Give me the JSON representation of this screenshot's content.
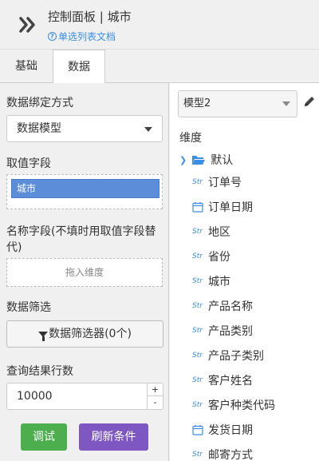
{
  "header": {
    "title": "控制面板 | 城市",
    "help_link": "单选列表文档"
  },
  "tabs": [
    {
      "label": "基础",
      "active": false
    },
    {
      "label": "数据",
      "active": true
    }
  ],
  "left": {
    "binding_label": "数据绑定方式",
    "binding_value": "数据模型",
    "value_field_label": "取值字段",
    "value_field_chip": "城市",
    "name_field_label": "名称字段(不填时用取值字段替代)",
    "name_field_hint": "拖入维度",
    "filter_label": "数据筛选",
    "filter_button": "数据筛选器(0个)",
    "rows_label": "查询结果行数",
    "rows_value": "10000",
    "stepper_up": "+",
    "stepper_down": "-",
    "debug_button": "调试",
    "refresh_button": "刷新条件"
  },
  "right": {
    "model_value": "模型2",
    "dimension_label": "维度",
    "folder_label": "默认",
    "str_tag": "Str",
    "fields": [
      {
        "label": "订单号",
        "type": "str"
      },
      {
        "label": "订单日期",
        "type": "date"
      },
      {
        "label": "地区",
        "type": "str"
      },
      {
        "label": "省份",
        "type": "str"
      },
      {
        "label": "城市",
        "type": "str"
      },
      {
        "label": "产品名称",
        "type": "str"
      },
      {
        "label": "产品类别",
        "type": "str"
      },
      {
        "label": "产品子类别",
        "type": "str"
      },
      {
        "label": "客户姓名",
        "type": "str"
      },
      {
        "label": "客户种类代码",
        "type": "str"
      },
      {
        "label": "发货日期",
        "type": "date"
      },
      {
        "label": "邮寄方式",
        "type": "str"
      }
    ]
  },
  "colors": {
    "accent": "#3a8ee6",
    "chip": "#5b8dd9",
    "debug": "#4cae4c",
    "refresh": "#7e57c2"
  }
}
